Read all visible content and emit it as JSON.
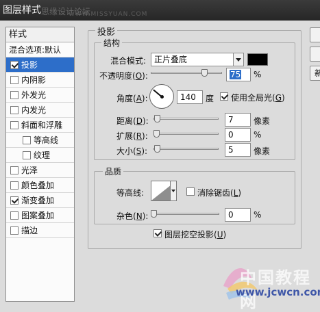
{
  "window": {
    "title": "图层样式",
    "watermark_cn": "思缘设计论坛",
    "watermark_url": "WWW.MISSYUAN.COM"
  },
  "sidebar": {
    "header": "样式",
    "blend_options": "混合选项:默认",
    "items": [
      {
        "label": "投影",
        "checked": true,
        "selected": true
      },
      {
        "label": "内阴影",
        "checked": false
      },
      {
        "label": "外发光",
        "checked": false
      },
      {
        "label": "内发光",
        "checked": false
      },
      {
        "label": "斜面和浮雕",
        "checked": false
      },
      {
        "label": "等高线",
        "checked": false
      },
      {
        "label": "纹理",
        "checked": false
      },
      {
        "label": "光泽",
        "checked": false
      },
      {
        "label": "颜色叠加",
        "checked": false
      },
      {
        "label": "渐变叠加",
        "checked": true
      },
      {
        "label": "图案叠加",
        "checked": false
      },
      {
        "label": "描边",
        "checked": false
      }
    ]
  },
  "panel": {
    "title": "投影",
    "structure": {
      "title": "结构",
      "blend_mode_label": "混合模式",
      "blend_mode_value": "正片叠底",
      "shadow_color": "#000000",
      "opacity_label": "不透明度",
      "opacity_key": "O",
      "opacity_value": "75",
      "opacity_unit": "%",
      "opacity_fraction": 0.75,
      "angle_label": "角度",
      "angle_key": "A",
      "angle_value": "140",
      "angle_unit": "度",
      "angle_degrees": 140,
      "global_light_label": "使用全局光",
      "global_light_key": "G",
      "global_light_checked": true,
      "distance_label": "距离",
      "distance_key": "D",
      "distance_value": "7",
      "distance_unit": "像素",
      "spread_label": "扩展",
      "spread_key": "R",
      "spread_value": "0",
      "spread_unit": "%",
      "size_label": "大小",
      "size_key": "S",
      "size_value": "5",
      "size_unit": "像素"
    },
    "quality": {
      "title": "品质",
      "contour_label": "等高线",
      "antialias_label": "消除锯齿",
      "antialias_key": "L",
      "antialias_checked": false,
      "noise_label": "杂色",
      "noise_key": "N",
      "noise_value": "0",
      "noise_unit": "%"
    },
    "knockout_label": "图层挖空投影",
    "knockout_key": "U",
    "knockout_checked": true
  },
  "right_buttons": [
    {
      "label": ""
    },
    {
      "label": ""
    },
    {
      "label": "新"
    }
  ],
  "watermark": {
    "big": "中国教程网",
    "small": "www.jcwcn.com"
  }
}
